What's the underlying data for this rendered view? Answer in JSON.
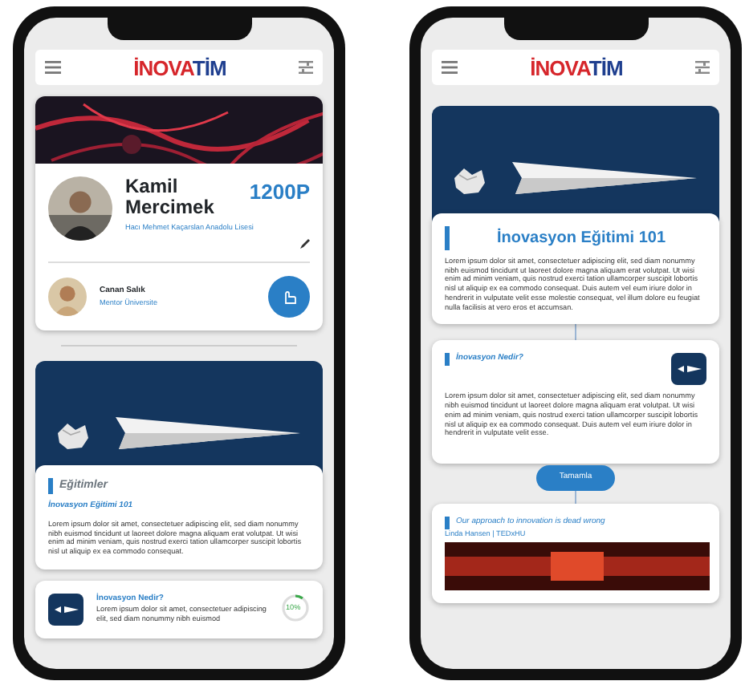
{
  "phones": [
    {
      "header": {
        "logo_red": "İNOVA",
        "logo_blue": "TİM"
      },
      "profile": {
        "name": "Kamil Mercimek",
        "points": "1200P",
        "school": "Hacı Mehmet Kaçarslan Anadolu Lisesi",
        "mentor_name": "Canan Salık",
        "mentor_role": "Mentor Üniversite"
      },
      "courses": {
        "heading": "Eğitimler",
        "course_title": "İnovasyon Eğitimi 101",
        "text": "Lorem ipsum dolor sit amet, consectetuer adipiscing elit, sed diam nonummy nibh euismod tincidunt ut laoreet dolore magna aliquam erat volutpat. Ut wisi enim ad minim veniam, quis nostrud exerci tation ullamcorper suscipit lobortis nisl ut aliquip ex ea commodo consequat.",
        "lesson": {
          "title": "İnovasyon Nedir?",
          "text": "Lorem ipsum dolor sit amet, consectetuer adipiscing elit, sed diam nonummy nibh euismod",
          "progress": "10%",
          "level": 0.1
        }
      }
    },
    {
      "header": {
        "logo_red": "İNOVA",
        "logo_blue": "TİM"
      },
      "course": {
        "title": "İnovasyon Eğitimi 101",
        "text": "Lorem ipsum dolor sit amet, consectetuer adipiscing elit, sed diam nonummy nibh euismod tincidunt ut laoreet dolore magna aliquam erat volutpat. Ut wisi enim ad minim veniam, quis nostrud exerci tation ullamcorper suscipit lobortis nisl ut aliquip ex ea commodo consequat. Duis autem vel eum iriure dolor in hendrerit in vulputate velit esse molestie consequat, vel illum dolore eu feugiat nulla facilisis at vero eros et accumsan."
      },
      "lesson": {
        "title": "İnovasyon Nedir?",
        "text": "Lorem ipsum dolor sit amet, consectetuer adipiscing elit, sed diam nonummy nibh euismod tincidunt ut laoreet dolore magna aliquam erat volutpat. Ut wisi enim ad minim veniam, quis nostrud exerci tation ullamcorper suscipit lobortis nisl ut aliquip ex ea commodo consequat. Duis autem vel eum iriure dolor in hendrerit in vulputate velit esse.",
        "button": "Tamamla"
      },
      "video": {
        "title": "Our approach to innovation is dead wrong",
        "speaker": "Linda Hansen | TEDxHU"
      }
    }
  ]
}
